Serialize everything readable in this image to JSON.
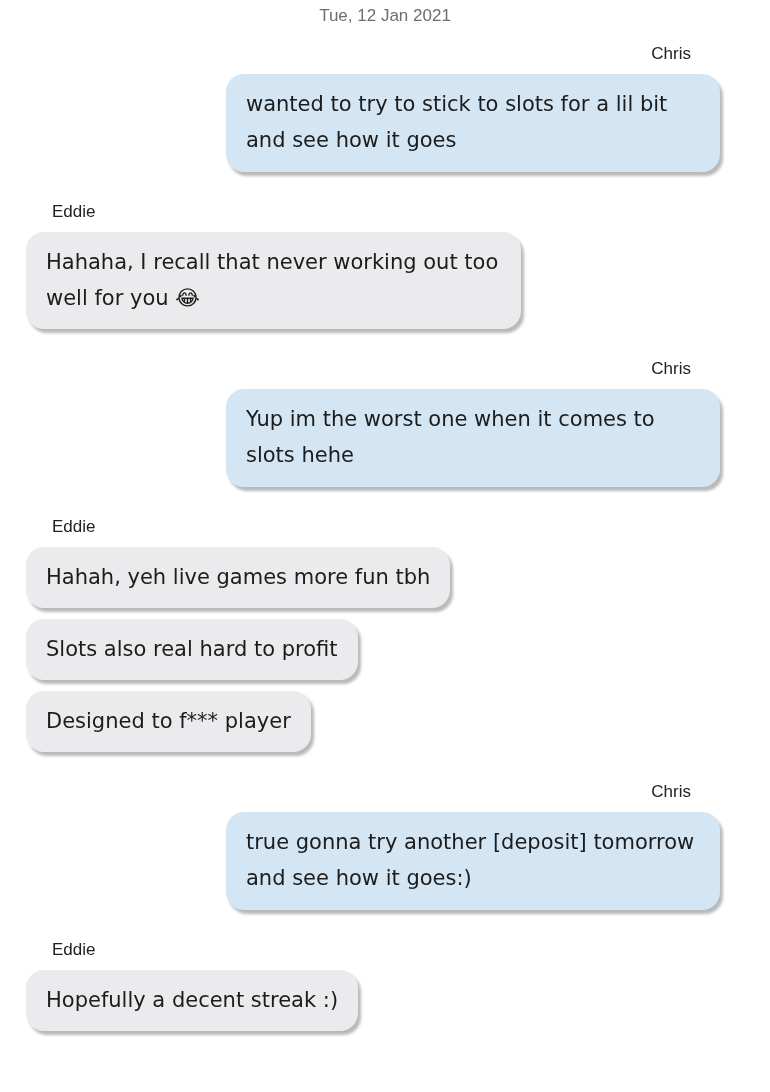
{
  "date": "Tue, 12 Jan 2021",
  "groups": [
    {
      "kind": "outgoing",
      "sender": "Chris",
      "messages": [
        "wanted to try to stick to slots for a lil bit and see how it goes"
      ]
    },
    {
      "kind": "incoming",
      "sender": "Eddie",
      "messages": [
        "Hahaha, I recall that never working out too well for you 😂"
      ]
    },
    {
      "kind": "outgoing",
      "sender": "Chris",
      "messages": [
        "Yup im the worst one when it comes to slots hehe"
      ]
    },
    {
      "kind": "incoming",
      "sender": "Eddie",
      "messages": [
        "Hahah, yeh live games more fun tbh",
        "Slots also real hard to profit",
        "Designed to f*** player"
      ]
    },
    {
      "kind": "outgoing",
      "sender": "Chris",
      "messages": [
        "true gonna try another [deposit] tomorrow and see how it goes:)"
      ]
    },
    {
      "kind": "incoming",
      "sender": "Eddie",
      "messages": [
        "Hopefully a decent streak :)"
      ]
    }
  ]
}
